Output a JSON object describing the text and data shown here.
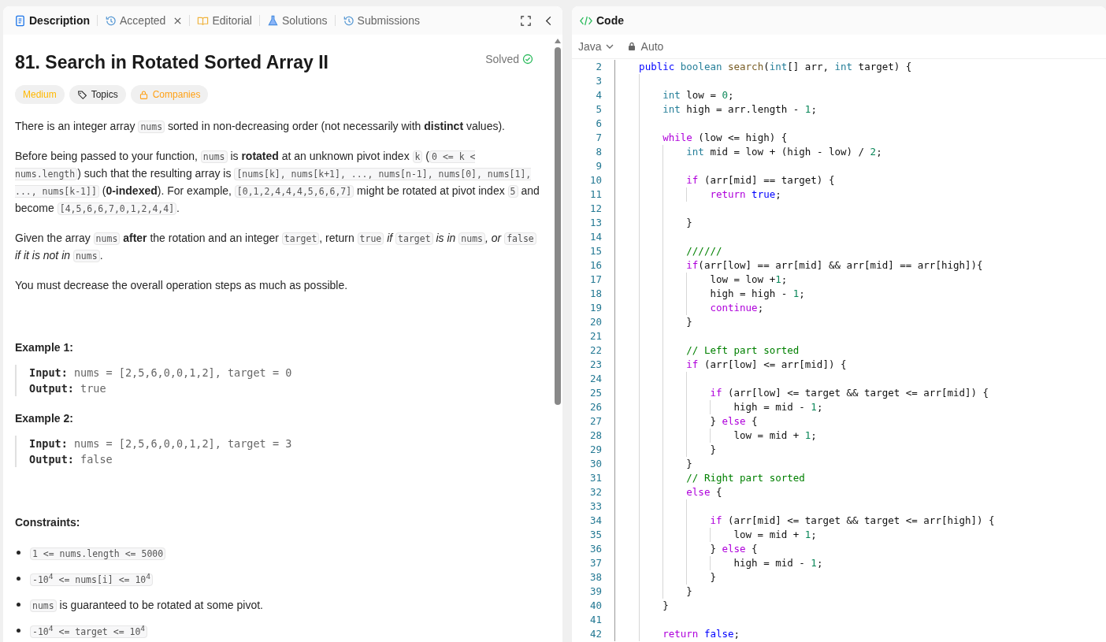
{
  "tabs": [
    {
      "label": "Description",
      "kind": "description",
      "selected": true,
      "closable": false
    },
    {
      "label": "Accepted",
      "kind": "history",
      "selected": false,
      "closable": true
    },
    {
      "label": "Editorial",
      "kind": "editorial",
      "selected": false,
      "closable": false
    },
    {
      "label": "Solutions",
      "kind": "solutions",
      "selected": false,
      "closable": false
    },
    {
      "label": "Submissions",
      "kind": "history",
      "selected": false,
      "closable": false
    }
  ],
  "problem": {
    "title": "81. Search in Rotated Sorted Array II",
    "status": "Solved",
    "tags": [
      {
        "label": "Medium",
        "kind": "difficulty"
      },
      {
        "label": "Topics",
        "kind": "topics"
      },
      {
        "label": "Companies",
        "kind": "companies"
      }
    ],
    "paragraphs": [
      [
        {
          "kind": "text",
          "text": "There is an integer array "
        },
        {
          "kind": "code",
          "text": "nums"
        },
        {
          "kind": "text",
          "text": " sorted in non-decreasing order (not necessarily with "
        },
        {
          "kind": "bold",
          "text": "distinct"
        },
        {
          "kind": "text",
          "text": " values)."
        }
      ],
      [
        {
          "kind": "text",
          "text": "Before being passed to your function, "
        },
        {
          "kind": "code",
          "text": "nums"
        },
        {
          "kind": "text",
          "text": " is "
        },
        {
          "kind": "bold",
          "text": "rotated"
        },
        {
          "kind": "text",
          "text": " at an unknown pivot index "
        },
        {
          "kind": "code",
          "text": "k"
        },
        {
          "kind": "text",
          "text": " ("
        },
        {
          "kind": "code",
          "text": "0 <= k < nums.length"
        },
        {
          "kind": "text",
          "text": ") such that the resulting array is "
        },
        {
          "kind": "code",
          "text": "[nums[k], nums[k+1], ..., nums[n-1], nums[0], nums[1], ..., nums[k-1]]"
        },
        {
          "kind": "text",
          "text": " ("
        },
        {
          "kind": "bold",
          "text": "0-indexed"
        },
        {
          "kind": "text",
          "text": "). For example, "
        },
        {
          "kind": "code",
          "text": "[0,1,2,4,4,4,5,6,6,7]"
        },
        {
          "kind": "text",
          "text": " might be rotated at pivot index "
        },
        {
          "kind": "code",
          "text": "5"
        },
        {
          "kind": "text",
          "text": " and become "
        },
        {
          "kind": "code",
          "text": "[4,5,6,6,7,0,1,2,4,4]"
        },
        {
          "kind": "text",
          "text": "."
        }
      ],
      [
        {
          "kind": "text",
          "text": "Given the array "
        },
        {
          "kind": "code",
          "text": "nums"
        },
        {
          "kind": "bold",
          "text": " after"
        },
        {
          "kind": "text",
          "text": " the rotation and an integer "
        },
        {
          "kind": "code",
          "text": "target"
        },
        {
          "kind": "text",
          "text": ", return "
        },
        {
          "kind": "code",
          "text": "true"
        },
        {
          "kind": "italic",
          "text": " if "
        },
        {
          "kind": "code",
          "text": "target"
        },
        {
          "kind": "italic",
          "text": " is in "
        },
        {
          "kind": "code",
          "text": "nums"
        },
        {
          "kind": "italic",
          "text": ", or "
        },
        {
          "kind": "code",
          "text": "false"
        },
        {
          "kind": "italic",
          "text": " if it is not in "
        },
        {
          "kind": "code",
          "text": "nums"
        },
        {
          "kind": "text",
          "text": "."
        }
      ],
      [
        {
          "kind": "text",
          "text": "You must decrease the overall operation steps as much as possible."
        }
      ]
    ],
    "examples": [
      {
        "heading": "Example 1:",
        "lines": [
          {
            "label": "Input:",
            "value": "nums = [2,5,6,0,0,1,2], target = 0"
          },
          {
            "label": "Output:",
            "value": "true"
          }
        ]
      },
      {
        "heading": "Example 2:",
        "lines": [
          {
            "label": "Input:",
            "value": "nums = [2,5,6,0,0,1,2], target = 3"
          },
          {
            "label": "Output:",
            "value": "false"
          }
        ]
      }
    ],
    "constraints": {
      "heading": "Constraints:",
      "items": [
        [
          {
            "kind": "code",
            "text": "1 <= nums.length <= 5000"
          }
        ],
        [
          {
            "kind": "code",
            "text": "-10$^{4}$ <= nums[i] <= 10$^{4}$"
          }
        ],
        [
          {
            "kind": "code",
            "text": "nums"
          },
          {
            "kind": "text",
            "text": " is guaranteed to be rotated at some pivot."
          }
        ],
        [
          {
            "kind": "code",
            "text": "-10$^{4}$ <= target <= 10$^{4}$"
          }
        ]
      ]
    }
  },
  "code_panel": {
    "title": "Code",
    "language": "Java",
    "mode": "Auto",
    "lines": [
      {
        "number": "2",
        "tokens": [
          {
            "kind": "literal",
            "text": "    public"
          },
          {
            "kind": "type",
            "text": " boolean"
          },
          {
            "kind": "function",
            "text": " search"
          },
          {
            "kind": "plain",
            "text": "("
          },
          {
            "kind": "type",
            "text": "int"
          },
          {
            "kind": "plain",
            "text": "[] arr, "
          },
          {
            "kind": "type",
            "text": "int"
          },
          {
            "kind": "plain",
            "text": " target) {"
          }
        ]
      },
      {
        "number": "3"
      },
      {
        "number": "4",
        "tokens": [
          {
            "kind": "type",
            "text": "        int"
          },
          {
            "kind": "plain",
            "text": " low = "
          },
          {
            "kind": "number",
            "text": "0"
          },
          {
            "kind": "plain",
            "text": ";"
          }
        ]
      },
      {
        "number": "5",
        "tokens": [
          {
            "kind": "type",
            "text": "        int"
          },
          {
            "kind": "plain",
            "text": " high = arr.length - "
          },
          {
            "kind": "number",
            "text": "1"
          },
          {
            "kind": "plain",
            "text": ";"
          }
        ]
      },
      {
        "number": "6"
      },
      {
        "number": "7",
        "tokens": [
          {
            "kind": "keyword",
            "text": "        while"
          },
          {
            "kind": "plain",
            "text": " (low <= high) {"
          }
        ]
      },
      {
        "number": "8",
        "tokens": [
          {
            "kind": "type",
            "text": "            int"
          },
          {
            "kind": "plain",
            "text": " mid = low + (high - low) / "
          },
          {
            "kind": "number",
            "text": "2"
          },
          {
            "kind": "plain",
            "text": ";"
          }
        ]
      },
      {
        "number": "9"
      },
      {
        "number": "10",
        "tokens": [
          {
            "kind": "keyword",
            "text": "            if"
          },
          {
            "kind": "plain",
            "text": " (arr[mid] == target) {"
          }
        ]
      },
      {
        "number": "11",
        "tokens": [
          {
            "kind": "keyword",
            "text": "                return"
          },
          {
            "kind": "literal",
            "text": " true"
          },
          {
            "kind": "plain",
            "text": ";"
          }
        ]
      },
      {
        "number": "12"
      },
      {
        "number": "13",
        "tokens": [
          {
            "kind": "plain",
            "text": "            }"
          }
        ]
      },
      {
        "number": "14"
      },
      {
        "number": "15",
        "tokens": [
          {
            "kind": "comment",
            "text": "            //////"
          }
        ]
      },
      {
        "number": "16",
        "tokens": [
          {
            "kind": "keyword",
            "text": "            if"
          },
          {
            "kind": "plain",
            "text": "(arr[low] == arr[mid] && arr[mid] == arr[high]){"
          }
        ]
      },
      {
        "number": "17",
        "tokens": [
          {
            "kind": "plain",
            "text": "                low = low +"
          },
          {
            "kind": "number",
            "text": "1"
          },
          {
            "kind": "plain",
            "text": ";"
          }
        ]
      },
      {
        "number": "18",
        "tokens": [
          {
            "kind": "plain",
            "text": "                high = high - "
          },
          {
            "kind": "number",
            "text": "1"
          },
          {
            "kind": "plain",
            "text": ";"
          }
        ]
      },
      {
        "number": "19",
        "tokens": [
          {
            "kind": "keyword",
            "text": "                continue"
          },
          {
            "kind": "plain",
            "text": ";"
          }
        ]
      },
      {
        "number": "20",
        "tokens": [
          {
            "kind": "plain",
            "text": "            }"
          }
        ]
      },
      {
        "number": "21"
      },
      {
        "number": "22",
        "tokens": [
          {
            "kind": "comment",
            "text": "            // Left part sorted"
          }
        ]
      },
      {
        "number": "23",
        "tokens": [
          {
            "kind": "keyword",
            "text": "            if"
          },
          {
            "kind": "plain",
            "text": " (arr[low] <= arr[mid]) {"
          }
        ]
      },
      {
        "number": "24"
      },
      {
        "number": "25",
        "tokens": [
          {
            "kind": "keyword",
            "text": "                if"
          },
          {
            "kind": "plain",
            "text": " (arr[low] <= target && target <= arr[mid]) {"
          }
        ]
      },
      {
        "number": "26",
        "tokens": [
          {
            "kind": "plain",
            "text": "                    high = mid - "
          },
          {
            "kind": "number",
            "text": "1"
          },
          {
            "kind": "plain",
            "text": ";"
          }
        ]
      },
      {
        "number": "27",
        "tokens": [
          {
            "kind": "plain",
            "text": "                } "
          },
          {
            "kind": "keyword",
            "text": "else"
          },
          {
            "kind": "plain",
            "text": " {"
          }
        ]
      },
      {
        "number": "28",
        "tokens": [
          {
            "kind": "plain",
            "text": "                    low = mid + "
          },
          {
            "kind": "number",
            "text": "1"
          },
          {
            "kind": "plain",
            "text": ";"
          }
        ]
      },
      {
        "number": "29",
        "tokens": [
          {
            "kind": "plain",
            "text": "                }"
          }
        ]
      },
      {
        "number": "30",
        "tokens": [
          {
            "kind": "plain",
            "text": "            }"
          }
        ]
      },
      {
        "number": "31",
        "tokens": [
          {
            "kind": "comment",
            "text": "            // Right part sorted"
          }
        ]
      },
      {
        "number": "32",
        "tokens": [
          {
            "kind": "keyword",
            "text": "            else"
          },
          {
            "kind": "plain",
            "text": " {"
          }
        ]
      },
      {
        "number": "33"
      },
      {
        "number": "34",
        "tokens": [
          {
            "kind": "keyword",
            "text": "                if"
          },
          {
            "kind": "plain",
            "text": " (arr[mid] <= target && target <= arr[high]) {"
          }
        ]
      },
      {
        "number": "35",
        "tokens": [
          {
            "kind": "plain",
            "text": "                    low = mid + "
          },
          {
            "kind": "number",
            "text": "1"
          },
          {
            "kind": "plain",
            "text": ";"
          }
        ]
      },
      {
        "number": "36",
        "tokens": [
          {
            "kind": "plain",
            "text": "                } "
          },
          {
            "kind": "keyword",
            "text": "else"
          },
          {
            "kind": "plain",
            "text": " {"
          }
        ]
      },
      {
        "number": "37",
        "tokens": [
          {
            "kind": "plain",
            "text": "                    high = mid - "
          },
          {
            "kind": "number",
            "text": "1"
          },
          {
            "kind": "plain",
            "text": ";"
          }
        ]
      },
      {
        "number": "38",
        "tokens": [
          {
            "kind": "plain",
            "text": "                }"
          }
        ]
      },
      {
        "number": "39",
        "tokens": [
          {
            "kind": "plain",
            "text": "            }"
          }
        ]
      },
      {
        "number": "40",
        "tokens": [
          {
            "kind": "plain",
            "text": "        }"
          }
        ]
      },
      {
        "number": "41"
      },
      {
        "number": "42",
        "tokens": [
          {
            "kind": "keyword",
            "text": "        return"
          },
          {
            "kind": "literal",
            "text": " false"
          },
          {
            "kind": "plain",
            "text": ";"
          }
        ]
      }
    ]
  }
}
